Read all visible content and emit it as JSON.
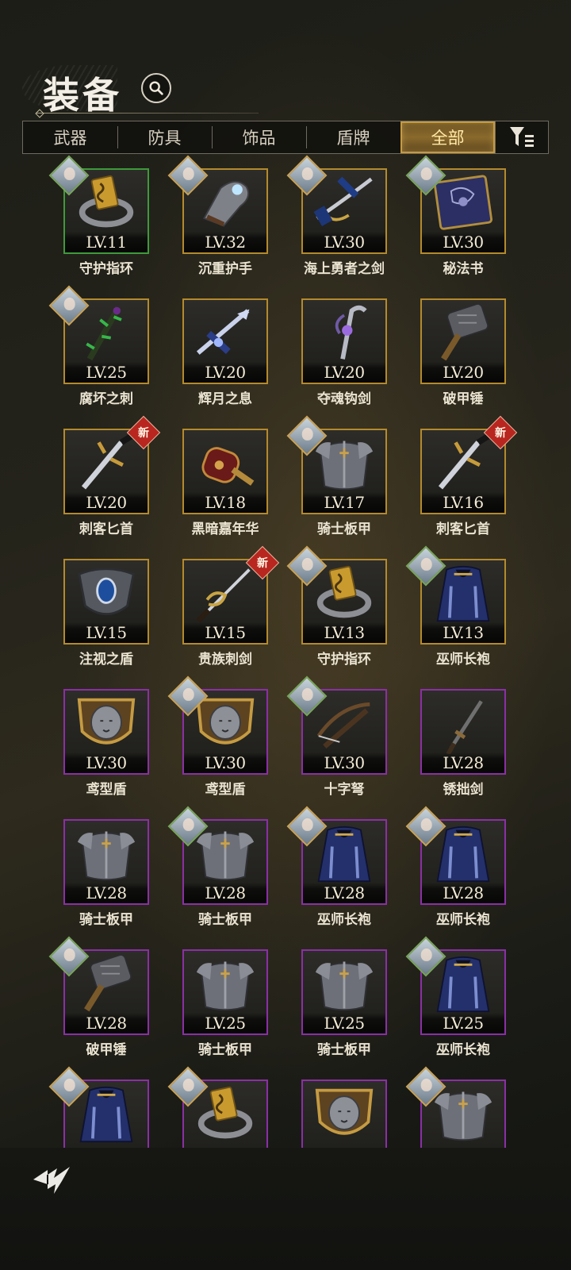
{
  "header": {
    "title": "装备"
  },
  "tabs": [
    {
      "label": "武器",
      "active": false
    },
    {
      "label": "防具",
      "active": false
    },
    {
      "label": "饰品",
      "active": false
    },
    {
      "label": "盾牌",
      "active": false
    },
    {
      "label": "全部",
      "active": true
    }
  ],
  "items": [
    {
      "level": "LV.11",
      "name": "守护指环",
      "quality": "green",
      "icon": "ring-icon",
      "portrait": true,
      "new": false
    },
    {
      "level": "LV.32",
      "name": "沉重护手",
      "quality": "gold",
      "icon": "gauntlet-icon",
      "portrait": true,
      "new": false
    },
    {
      "level": "LV.30",
      "name": "海上勇者之剑",
      "quality": "gold",
      "icon": "saber-icon",
      "portrait": true,
      "new": false
    },
    {
      "level": "LV.30",
      "name": "秘法书",
      "quality": "gold",
      "icon": "spellbook-icon",
      "portrait": true,
      "new": false
    },
    {
      "level": "LV.25",
      "name": "腐坏之刺",
      "quality": "gold",
      "icon": "thorn-staff-icon",
      "portrait": true,
      "new": false
    },
    {
      "level": "LV.20",
      "name": "辉月之息",
      "quality": "gold",
      "icon": "moon-sword-icon",
      "portrait": false,
      "new": false
    },
    {
      "level": "LV.20",
      "name": "夺魂钩剑",
      "quality": "gold",
      "icon": "hook-sword-icon",
      "portrait": false,
      "new": false
    },
    {
      "level": "LV.20",
      "name": "破甲锤",
      "quality": "gold",
      "icon": "hammer-icon",
      "portrait": false,
      "new": false
    },
    {
      "level": "LV.20",
      "name": "刺客匕首",
      "quality": "gold",
      "icon": "dagger-icon",
      "portrait": false,
      "new": true
    },
    {
      "level": "LV.18",
      "name": "黑暗嘉年华",
      "quality": "gold",
      "icon": "mace-icon",
      "portrait": false,
      "new": false
    },
    {
      "level": "LV.17",
      "name": "骑士板甲",
      "quality": "gold",
      "icon": "plate-armor-icon",
      "portrait": true,
      "new": false
    },
    {
      "level": "LV.16",
      "name": "刺客匕首",
      "quality": "gold",
      "icon": "dagger-icon",
      "portrait": false,
      "new": true
    },
    {
      "level": "LV.15",
      "name": "注视之盾",
      "quality": "gold",
      "icon": "eye-shield-icon",
      "portrait": false,
      "new": false
    },
    {
      "level": "LV.15",
      "name": "贵族刺剑",
      "quality": "gold",
      "icon": "rapier-icon",
      "portrait": false,
      "new": true
    },
    {
      "level": "LV.13",
      "name": "守护指环",
      "quality": "gold",
      "icon": "ring-icon",
      "portrait": true,
      "new": false
    },
    {
      "level": "LV.13",
      "name": "巫师长袍",
      "quality": "gold",
      "icon": "robe-icon",
      "portrait": true,
      "new": false
    },
    {
      "level": "LV.30",
      "name": "鸢型盾",
      "quality": "purple",
      "icon": "lion-shield-icon",
      "portrait": false,
      "new": false
    },
    {
      "level": "LV.30",
      "name": "鸢型盾",
      "quality": "purple",
      "icon": "lion-shield-icon",
      "portrait": true,
      "new": false
    },
    {
      "level": "LV.30",
      "name": "十字弩",
      "quality": "purple",
      "icon": "crossbow-icon",
      "portrait": true,
      "new": false
    },
    {
      "level": "LV.28",
      "name": "锈拙剑",
      "quality": "purple",
      "icon": "rusty-sword-icon",
      "portrait": false,
      "new": false
    },
    {
      "level": "LV.28",
      "name": "骑士板甲",
      "quality": "purple",
      "icon": "plate-armor-icon",
      "portrait": false,
      "new": false
    },
    {
      "level": "LV.28",
      "name": "骑士板甲",
      "quality": "purple",
      "icon": "plate-armor-icon",
      "portrait": true,
      "new": false
    },
    {
      "level": "LV.28",
      "name": "巫师长袍",
      "quality": "purple",
      "icon": "robe-icon",
      "portrait": true,
      "new": false
    },
    {
      "level": "LV.28",
      "name": "巫师长袍",
      "quality": "purple",
      "icon": "robe-icon",
      "portrait": true,
      "new": false
    },
    {
      "level": "LV.28",
      "name": "破甲锤",
      "quality": "purple",
      "icon": "hammer-icon",
      "portrait": true,
      "new": false
    },
    {
      "level": "LV.25",
      "name": "骑士板甲",
      "quality": "purple",
      "icon": "plate-armor-icon",
      "portrait": false,
      "new": false
    },
    {
      "level": "LV.25",
      "name": "骑士板甲",
      "quality": "purple",
      "icon": "plate-armor-icon",
      "portrait": false,
      "new": false
    },
    {
      "level": "LV.25",
      "name": "巫师长袍",
      "quality": "purple",
      "icon": "robe-icon",
      "portrait": true,
      "new": false
    },
    {
      "level": "",
      "name": "",
      "quality": "purple",
      "icon": "robe-icon",
      "portrait": true,
      "new": false
    },
    {
      "level": "",
      "name": "",
      "quality": "purple",
      "icon": "ring-icon",
      "portrait": true,
      "new": false
    },
    {
      "level": "",
      "name": "",
      "quality": "purple",
      "icon": "lion-shield-icon",
      "portrait": false,
      "new": false
    },
    {
      "level": "",
      "name": "",
      "quality": "purple",
      "icon": "plate-armor-icon",
      "portrait": true,
      "new": false
    }
  ],
  "badges": {
    "new_label": "新"
  },
  "colors": {
    "gold_frame": "#b48a2c",
    "green_frame": "#3e9a3a",
    "purple_frame": "#8b2fa5",
    "new_badge": "#b8261f"
  }
}
